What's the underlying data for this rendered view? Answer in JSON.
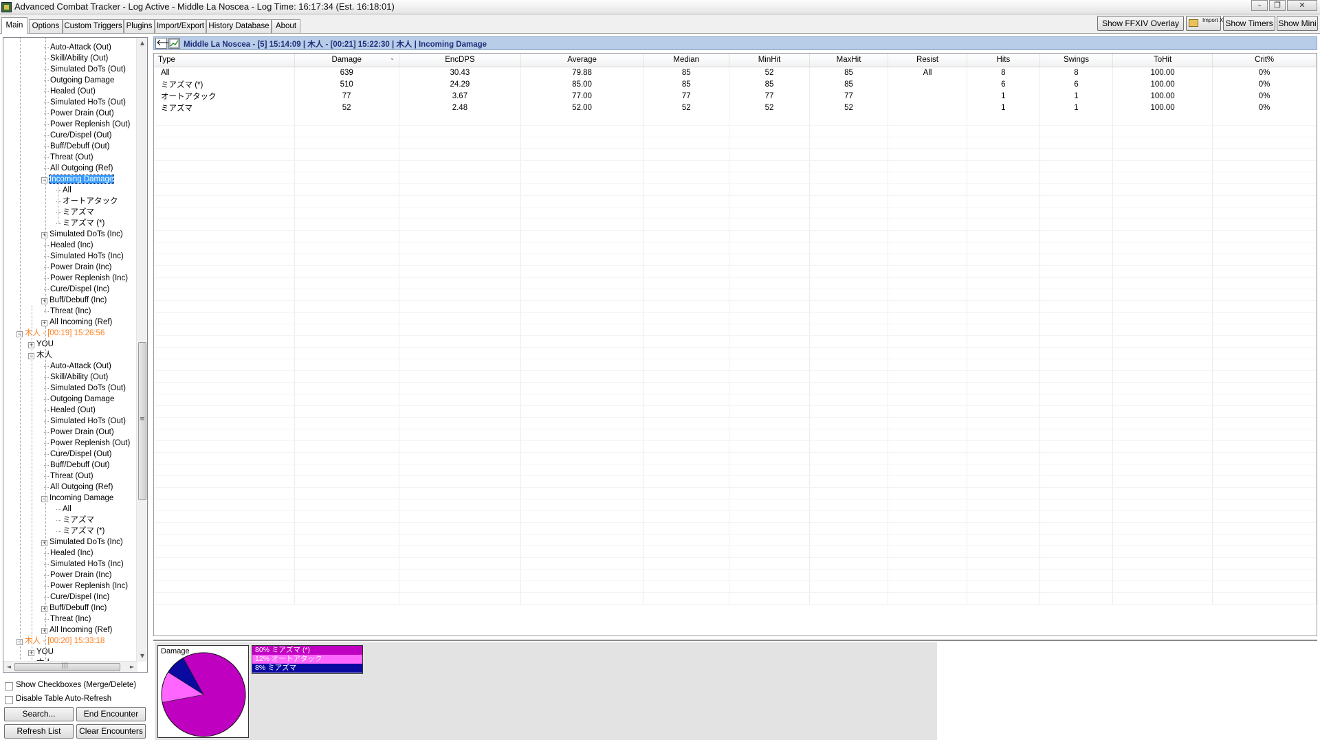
{
  "window": {
    "title": "Advanced Combat Tracker - Log Active - Middle La Noscea - Log Time: 16:17:34 (Est. 16:18:01)",
    "minimize_glyph": "–",
    "restore_glyph": "❐",
    "close_glyph": "✕"
  },
  "tabs": [
    {
      "label": "Main",
      "active": true
    },
    {
      "label": "Options"
    },
    {
      "label": "Custom Triggers"
    },
    {
      "label": "Plugins"
    },
    {
      "label": "Import/Export"
    },
    {
      "label": "History Database"
    },
    {
      "label": "About"
    }
  ],
  "toolbar": {
    "overlay_label": "Show FFXIV Overlay",
    "import_xml_label": "Import XML",
    "timers_label": "Show Timers",
    "mini_label": "Show Mini"
  },
  "tree": {
    "nodes": [
      {
        "label": "Auto-Attack (Out)",
        "level": 3
      },
      {
        "label": "Skill/Ability (Out)",
        "level": 3
      },
      {
        "label": "Simulated DoTs (Out)",
        "level": 3
      },
      {
        "label": "Outgoing Damage",
        "level": 3
      },
      {
        "label": "Healed (Out)",
        "level": 3
      },
      {
        "label": "Simulated HoTs (Out)",
        "level": 3
      },
      {
        "label": "Power Drain (Out)",
        "level": 3
      },
      {
        "label": "Power Replenish (Out)",
        "level": 3
      },
      {
        "label": "Cure/Dispel (Out)",
        "level": 3
      },
      {
        "label": "Buff/Debuff (Out)",
        "level": 3
      },
      {
        "label": "Threat (Out)",
        "level": 3
      },
      {
        "label": "All Outgoing (Ref)",
        "level": 3
      },
      {
        "label": "Incoming Damage",
        "level": 3,
        "toggle": "−",
        "selected": true
      },
      {
        "label": "All",
        "level": 4
      },
      {
        "label": "オートアタック",
        "level": 4
      },
      {
        "label": "ミアズマ",
        "level": 4
      },
      {
        "label": "ミアズマ (*)",
        "level": 4
      },
      {
        "label": "Simulated DoTs (Inc)",
        "level": 3,
        "toggle": "+"
      },
      {
        "label": "Healed (Inc)",
        "level": 3
      },
      {
        "label": "Simulated HoTs (Inc)",
        "level": 3
      },
      {
        "label": "Power Drain (Inc)",
        "level": 3
      },
      {
        "label": "Power Replenish (Inc)",
        "level": 3
      },
      {
        "label": "Cure/Dispel (Inc)",
        "level": 3
      },
      {
        "label": "Buff/Debuff (Inc)",
        "level": 3,
        "toggle": "+"
      },
      {
        "label": "Threat (Inc)",
        "level": 3
      },
      {
        "label": "All Incoming (Ref)",
        "level": 3,
        "toggle": "+"
      },
      {
        "label": "木人 - [00:19] 15:26:56",
        "level": 1,
        "toggle": "−",
        "encounter": true
      },
      {
        "label": "YOU",
        "level": 2,
        "toggle": "+"
      },
      {
        "label": "木人",
        "level": 2,
        "toggle": "−"
      },
      {
        "label": "Auto-Attack (Out)",
        "level": 3
      },
      {
        "label": "Skill/Ability (Out)",
        "level": 3
      },
      {
        "label": "Simulated DoTs (Out)",
        "level": 3
      },
      {
        "label": "Outgoing Damage",
        "level": 3
      },
      {
        "label": "Healed (Out)",
        "level": 3
      },
      {
        "label": "Simulated HoTs (Out)",
        "level": 3
      },
      {
        "label": "Power Drain (Out)",
        "level": 3
      },
      {
        "label": "Power Replenish (Out)",
        "level": 3
      },
      {
        "label": "Cure/Dispel (Out)",
        "level": 3
      },
      {
        "label": "Buff/Debuff (Out)",
        "level": 3
      },
      {
        "label": "Threat (Out)",
        "level": 3
      },
      {
        "label": "All Outgoing (Ref)",
        "level": 3
      },
      {
        "label": "Incoming Damage",
        "level": 3,
        "toggle": "−"
      },
      {
        "label": "All",
        "level": 4
      },
      {
        "label": "ミアズマ",
        "level": 4
      },
      {
        "label": "ミアズマ (*)",
        "level": 4
      },
      {
        "label": "Simulated DoTs (Inc)",
        "level": 3,
        "toggle": "+"
      },
      {
        "label": "Healed (Inc)",
        "level": 3
      },
      {
        "label": "Simulated HoTs (Inc)",
        "level": 3
      },
      {
        "label": "Power Drain (Inc)",
        "level": 3
      },
      {
        "label": "Power Replenish (Inc)",
        "level": 3
      },
      {
        "label": "Cure/Dispel (Inc)",
        "level": 3
      },
      {
        "label": "Buff/Debuff (Inc)",
        "level": 3,
        "toggle": "+"
      },
      {
        "label": "Threat (Inc)",
        "level": 3
      },
      {
        "label": "All Incoming (Ref)",
        "level": 3,
        "toggle": "+"
      },
      {
        "label": "木人 - [00:20] 15:33:18",
        "level": 1,
        "toggle": "−",
        "encounter": true
      },
      {
        "label": "YOU",
        "level": 2,
        "toggle": "+"
      },
      {
        "label": "木人",
        "level": 2,
        "toggle": "+"
      }
    ],
    "scroll_up": "▲",
    "scroll_down": "▼",
    "scroll_left": "◄",
    "scroll_right": "►",
    "scroll_grip": "≡",
    "hscroll_grip": "|||"
  },
  "options": {
    "show_checkboxes_label": "Show Checkboxes (Merge/Delete)",
    "disable_refresh_label": "Disable Table Auto-Refresh"
  },
  "buttons": {
    "search": "Search...",
    "end_encounter": "End Encounter",
    "refresh_list": "Refresh List",
    "clear_encounters": "Clear Encounters"
  },
  "header": {
    "back_glyph": "🡐",
    "text": "Middle La Noscea - [5] 15:14:09 | 木人 - [00:21] 15:22:30 | 木人 | Incoming Damage"
  },
  "table": {
    "columns": [
      "Type",
      "Damage",
      "EncDPS",
      "Average",
      "Median",
      "MinHit",
      "MaxHit",
      "Resist",
      "Hits",
      "Swings",
      "ToHit",
      "Crit%"
    ],
    "sort_glyph": "⌄",
    "rows": [
      [
        "All",
        "639",
        "30.43",
        "79.88",
        "85",
        "52",
        "85",
        "All",
        "8",
        "8",
        "100.00",
        "0%"
      ],
      [
        "ミアズマ (*)",
        "510",
        "24.29",
        "85.00",
        "85",
        "85",
        "85",
        "",
        "6",
        "6",
        "100.00",
        "0%"
      ],
      [
        "オートアタック",
        "77",
        "3.67",
        "77.00",
        "77",
        "77",
        "77",
        "",
        "1",
        "1",
        "100.00",
        "0%"
      ],
      [
        "ミアズマ",
        "52",
        "2.48",
        "52.00",
        "52",
        "52",
        "52",
        "",
        "1",
        "1",
        "100.00",
        "0%"
      ]
    ]
  },
  "chart_data": {
    "type": "pie",
    "title": "Damage",
    "series": [
      {
        "name": "ミアズマ (*)",
        "label": "80%  ミアズマ (*)",
        "percent": 80,
        "color": "#c000c0"
      },
      {
        "name": "オートアタック",
        "label": "12%  オートアタック",
        "percent": 12,
        "color": "#ff66ff"
      },
      {
        "name": "ミアズマ",
        "label": "8%   ミアズマ",
        "percent": 8,
        "color": "#0a0aa0"
      }
    ]
  }
}
